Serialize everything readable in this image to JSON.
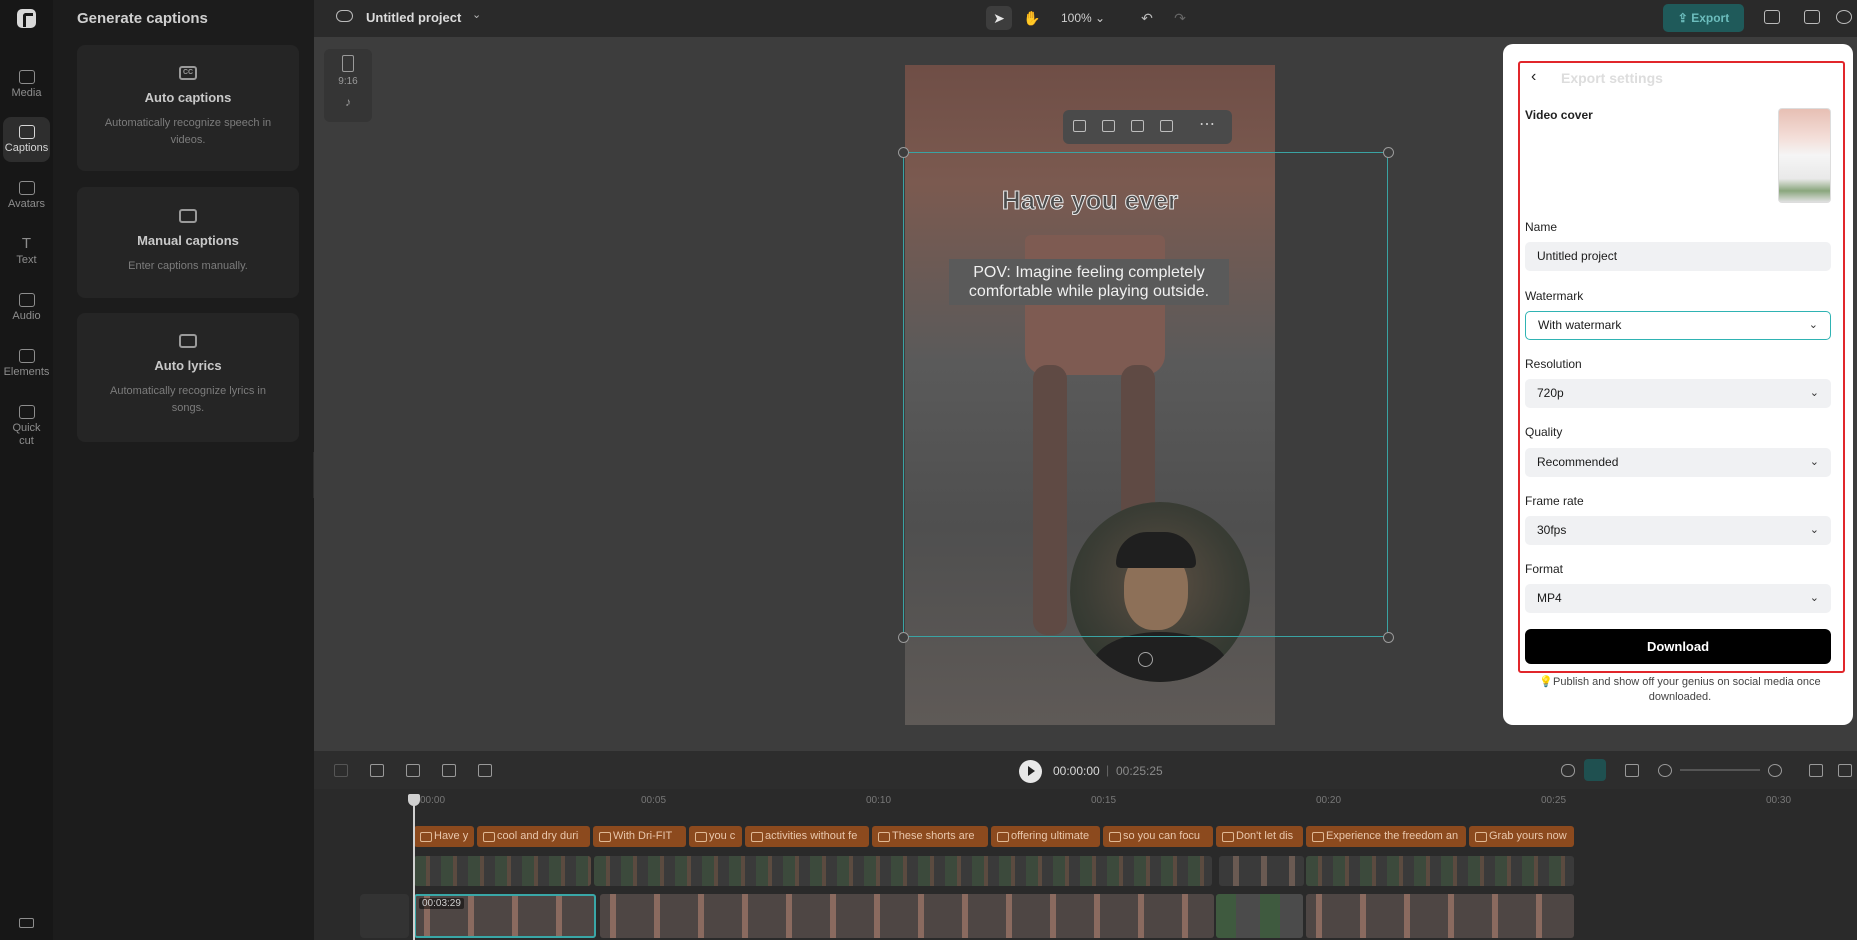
{
  "rail": {
    "items": [
      {
        "label": "Media",
        "icon": "cloud-upload-icon"
      },
      {
        "label": "Captions",
        "icon": "captions-icon",
        "active": true
      },
      {
        "label": "Avatars",
        "icon": "avatar-icon"
      },
      {
        "label": "Text",
        "icon": "text-icon"
      },
      {
        "label": "Audio",
        "icon": "music-icon"
      },
      {
        "label": "Elements",
        "icon": "elements-icon"
      },
      {
        "label": "Quick cut",
        "icon": "quick-cut-icon"
      }
    ]
  },
  "panel": {
    "title": "Generate captions",
    "cards": [
      {
        "title": "Auto captions",
        "desc": "Automatically recognize speech in videos.",
        "icon": "cc-icon"
      },
      {
        "title": "Manual captions",
        "desc": "Enter captions manually.",
        "icon": "keyboard-icon"
      },
      {
        "title": "Auto lyrics",
        "desc": "Automatically recognize lyrics in songs.",
        "icon": "lyrics-icon"
      }
    ]
  },
  "topbar": {
    "project_name": "Untitled project",
    "zoom": "100%",
    "export_label": "Export"
  },
  "canvas": {
    "ratio_label": "9:16",
    "caption_top": "Have you ever",
    "caption_main": "POV: Imagine feeling completely comfortable while playing outside."
  },
  "export_dialog": {
    "title": "Export settings",
    "video_cover_label": "Video cover",
    "name_label": "Name",
    "name_value": "Untitled project",
    "watermark_label": "Watermark",
    "watermark_value": "With watermark",
    "resolution_label": "Resolution",
    "resolution_value": "720p",
    "quality_label": "Quality",
    "quality_value": "Recommended",
    "framerate_label": "Frame rate",
    "framerate_value": "30fps",
    "format_label": "Format",
    "format_value": "MP4",
    "download_label": "Download",
    "tip": "Publish and show off your genius on social media once downloaded.",
    "highlight_color": "#e1262b"
  },
  "timeline": {
    "current_time": "00:00:00",
    "total_time": "00:25:25",
    "ruler_labels": [
      "00:00",
      "00:05",
      "00:10",
      "00:15",
      "00:20",
      "00:25",
      "00:30"
    ],
    "caption_clips": [
      "Have y",
      "cool and dry duri",
      "With Dri-FIT",
      "you c",
      "activities without fe",
      "These shorts are",
      "offering ultimate",
      "so you can focu",
      "Don't let dis",
      "Experience the freedom an",
      "Grab yours now"
    ],
    "selected_clip_time": "00:03:29"
  }
}
